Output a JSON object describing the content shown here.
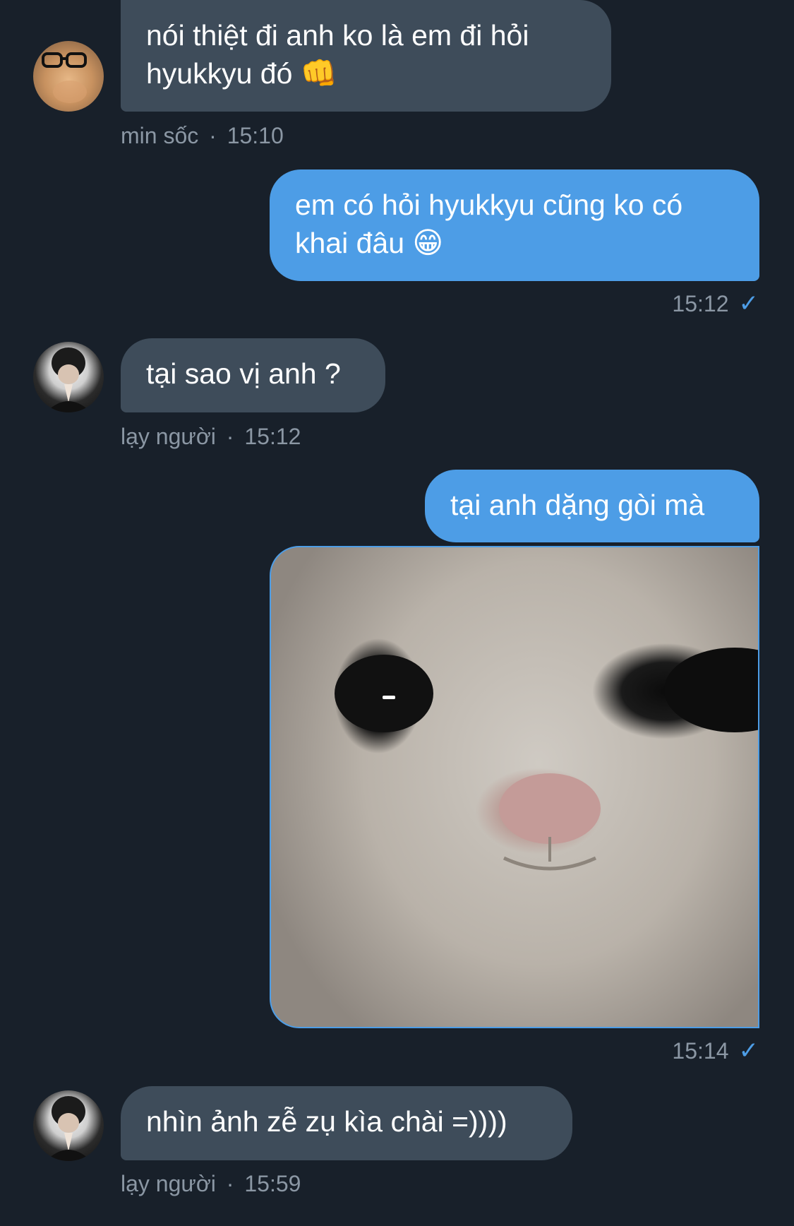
{
  "messages": [
    {
      "direction": "incoming",
      "text": "nói thiệt đi anh ko là em đi hỏi hyukkyu đó 👊",
      "text_lines": [
        "nói thiệt đi anh ko là em đi hỏi",
        "hyukkyu đó"
      ],
      "emoji": "👊",
      "sender": "min sốc",
      "time": "15:10",
      "avatar": "cat-with-glasses-avatar"
    },
    {
      "direction": "outgoing",
      "text_lines": [
        "em có hỏi hyukkyu cũng ko có",
        "khai đâu"
      ],
      "emoji": "😁",
      "time": "15:12",
      "status": "✓"
    },
    {
      "direction": "incoming",
      "text": "tại sao vị anh ?",
      "sender": "lạy người",
      "time": "15:12",
      "avatar": "boy-praying-avatar"
    },
    {
      "direction": "outgoing",
      "text": "tại anh dặng gòi mà",
      "attachment": "cat-face-photo",
      "time": "15:14",
      "status": "✓"
    },
    {
      "direction": "incoming",
      "text": "nhìn ảnh zễ zụ kìa chài =))))",
      "sender": "lạy người",
      "time": "15:59",
      "avatar": "boy-praying-avatar"
    }
  ],
  "separator": "·",
  "colors": {
    "background": "#18202a",
    "incoming_bubble": "#3e4c5a",
    "outgoing_bubble": "#4d9de6",
    "meta_text": "#8b97a4",
    "check": "#4d9de6"
  }
}
